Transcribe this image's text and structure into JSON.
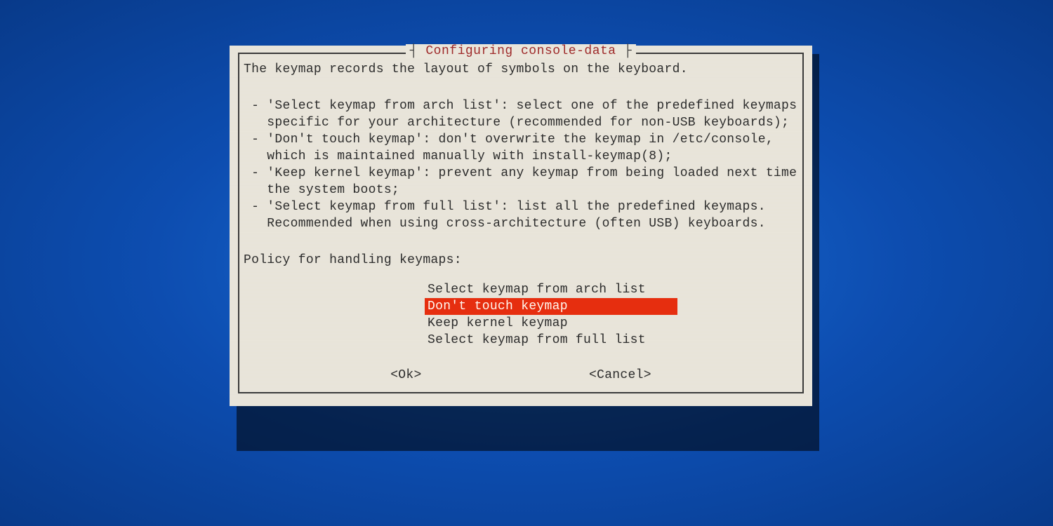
{
  "dialog": {
    "title_left_sep": "┤",
    "title": " Configuring console-data ",
    "title_right_sep": "├",
    "intro": "The keymap records the layout of symbols on the keyboard.",
    "bullets_text": " - 'Select keymap from arch list': select one of the predefined keymaps\n   specific for your architecture (recommended for non-USB keyboards);\n - 'Don't touch keymap': don't overwrite the keymap in /etc/console,\n   which is maintained manually with install-keymap(8);\n - 'Keep kernel keymap': prevent any keymap from being loaded next time\n   the system boots;\n - 'Select keymap from full list': list all the predefined keymaps.\n   Recommended when using cross-architecture (often USB) keyboards.",
    "prompt": "Policy for handling keymaps:",
    "menu": {
      "selected_index": 1,
      "items": [
        "Select keymap from arch list",
        "Don't touch keymap",
        "Keep kernel keymap",
        "Select keymap from full list"
      ]
    },
    "buttons": {
      "ok": "<Ok>",
      "cancel": "<Cancel>"
    }
  }
}
